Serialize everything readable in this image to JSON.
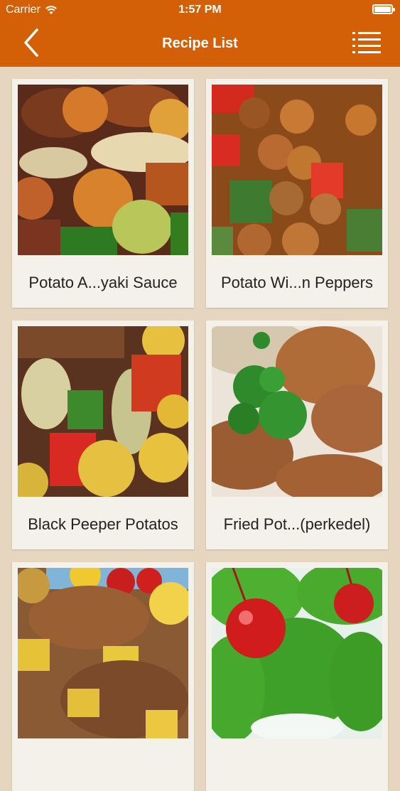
{
  "status_bar": {
    "carrier": "Carrier",
    "time": "1:57 PM"
  },
  "nav": {
    "title": "Recipe List",
    "back_icon": "chevron-left-icon",
    "menu_icon": "list-menu-icon"
  },
  "colors": {
    "header": "#d35f06",
    "background": "#e6d6bf",
    "card": "#f4f0ea"
  },
  "recipes": [
    {
      "label": "Potato A...yaki Sauce"
    },
    {
      "label": "Potato Wi...n Peppers"
    },
    {
      "label": "Black Peeper Potatos"
    },
    {
      "label": "Fried Pot...(perkedel)"
    },
    {
      "label": ""
    },
    {
      "label": ""
    }
  ]
}
